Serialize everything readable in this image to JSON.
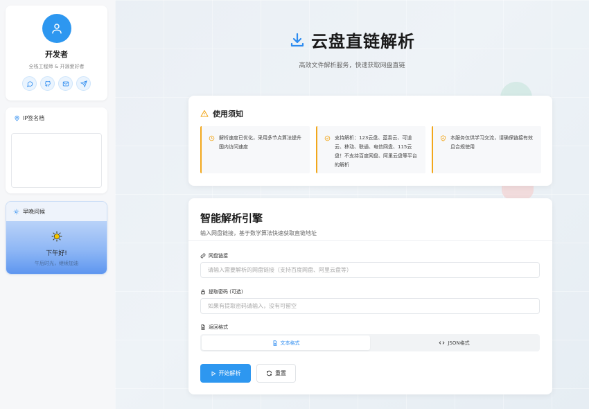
{
  "profile": {
    "name": "开发者",
    "description": "全栈工程师 & 开源爱好者",
    "social": [
      "chat-icon",
      "github-icon",
      "mail-icon",
      "send-icon"
    ]
  },
  "ip_card": {
    "title": "IP签名档"
  },
  "weather": {
    "title": "早晚问候",
    "greeting": "下午好!",
    "subtext": "午后时光，继续加油"
  },
  "header": {
    "title": "云盘直链解析",
    "subtitle": "高效文件解析服务，快速获取网盘直链"
  },
  "notice": {
    "title": "使用须知",
    "items": [
      {
        "icon": "clock-icon",
        "text": "解析速度已优化，采用多节点算法提升国内访问速度"
      },
      {
        "icon": "check-circle-icon",
        "text": "支持解析：123云盘、蓝奏云、可道云、移动、联通、电信网盘、115云盘！不支持百度网盘、阿里云盘等平台的解析"
      },
      {
        "icon": "shield-check-icon",
        "text": "本服务仅供学习交流，请确保链接有效且合规使用"
      }
    ]
  },
  "engine": {
    "title": "智能解析引擎",
    "subtitle": "输入网盘链接，基于数学算法快速获取直链地址",
    "link_label": "网盘链接",
    "link_placeholder": "请输入需要解析的网盘链接（支持百度网盘、阿里云盘等）",
    "password_label": "提取密码 (可选)",
    "password_placeholder": "如果有提取密码请输入，没有可留空",
    "format_label": "返回格式",
    "format_options": [
      "文本格式",
      "JSON格式"
    ],
    "format_selected": "文本格式",
    "start_button": "开始解析",
    "reset_button": "重置"
  },
  "colors": {
    "accent": "#2d97f0",
    "warning": "#f2a71b"
  }
}
